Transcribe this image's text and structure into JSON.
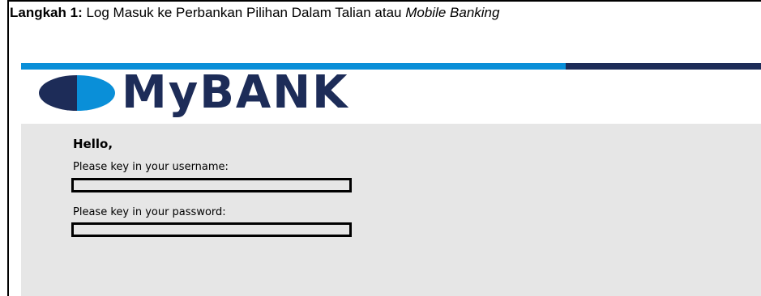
{
  "heading": {
    "step": "Langkah 1:",
    "text": " Log Masuk ke Perbankan Pilihan Dalam Talian atau ",
    "italic": "Mobile Banking"
  },
  "bank": {
    "name": "MyBANK"
  },
  "login": {
    "greeting": "Hello,",
    "username_label": "Please key in your username:",
    "username_value": "",
    "password_label": "Please key in your password:",
    "password_value": ""
  },
  "colors": {
    "navy": "#1d2c58",
    "blue": "#0a8fd8",
    "panel": "#e6e6e6"
  }
}
